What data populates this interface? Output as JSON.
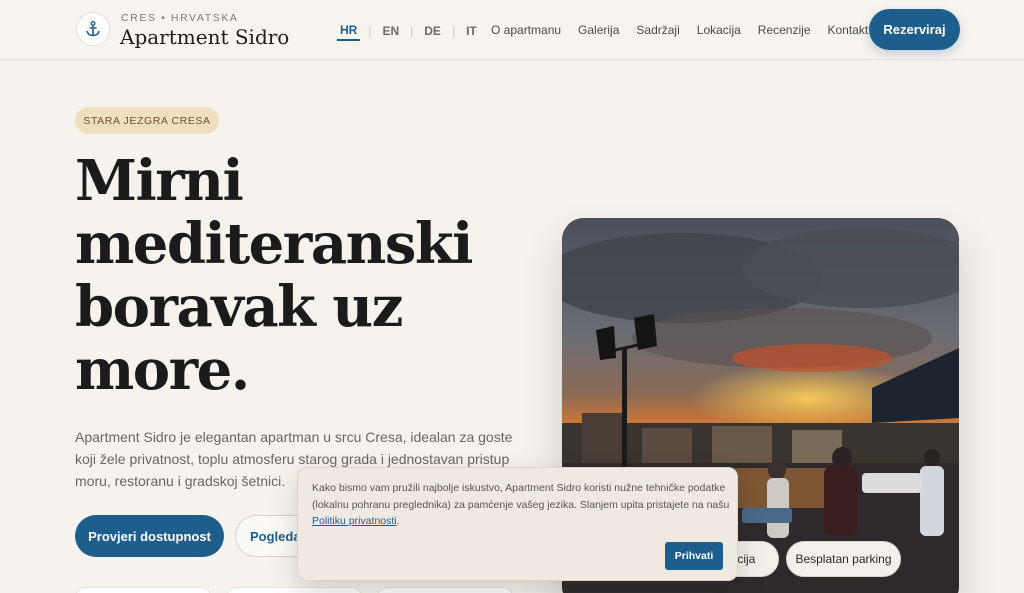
{
  "header": {
    "brand_sub": "CRES • HRVATSKA",
    "brand_title": "Apartment Sidro",
    "logo_icon": "anchor-icon",
    "languages": [
      "HR",
      "EN",
      "DE",
      "IT"
    ],
    "active_language": "HR",
    "nav": [
      "O apartmanu",
      "Galerija",
      "Sadržaji",
      "Lokacija",
      "Recenzije",
      "Kontakt"
    ],
    "book_label": "Rezerviraj"
  },
  "hero": {
    "pill": "STARA JEZGRA CRESA",
    "title_lines": [
      "Mirni",
      "mediteranski",
      "boravak uz",
      "more."
    ],
    "description": "Apartment Sidro je elegantan apartman u srcu Cresa, idealan za goste koji žele privatnost, toplu atmosferu starog grada i jednostavan pristup moru, restoranu i gradskoj šetnici.",
    "primary_cta": "Provjeri dostupnost",
    "secondary_cta": "Pogleda"
  },
  "photo": {
    "tags": [
      "kacija",
      "Besplatan parking"
    ]
  },
  "cookie": {
    "text_before": "Kako bismo vam pružili najbolje iskustvo, Apartment Sidro koristi nužne tehničke podatke (lokalnu pohranu preglednika) za pamćenje vašeg jezika. Slanjem upita pristajete na našu ",
    "link": "Politiku privatnosti",
    "text_after": ".",
    "accept_label": "Prihvati"
  },
  "colors": {
    "accent": "#1e5e8c",
    "background": "#f6f3ee",
    "pill": "#f0dfbd"
  }
}
